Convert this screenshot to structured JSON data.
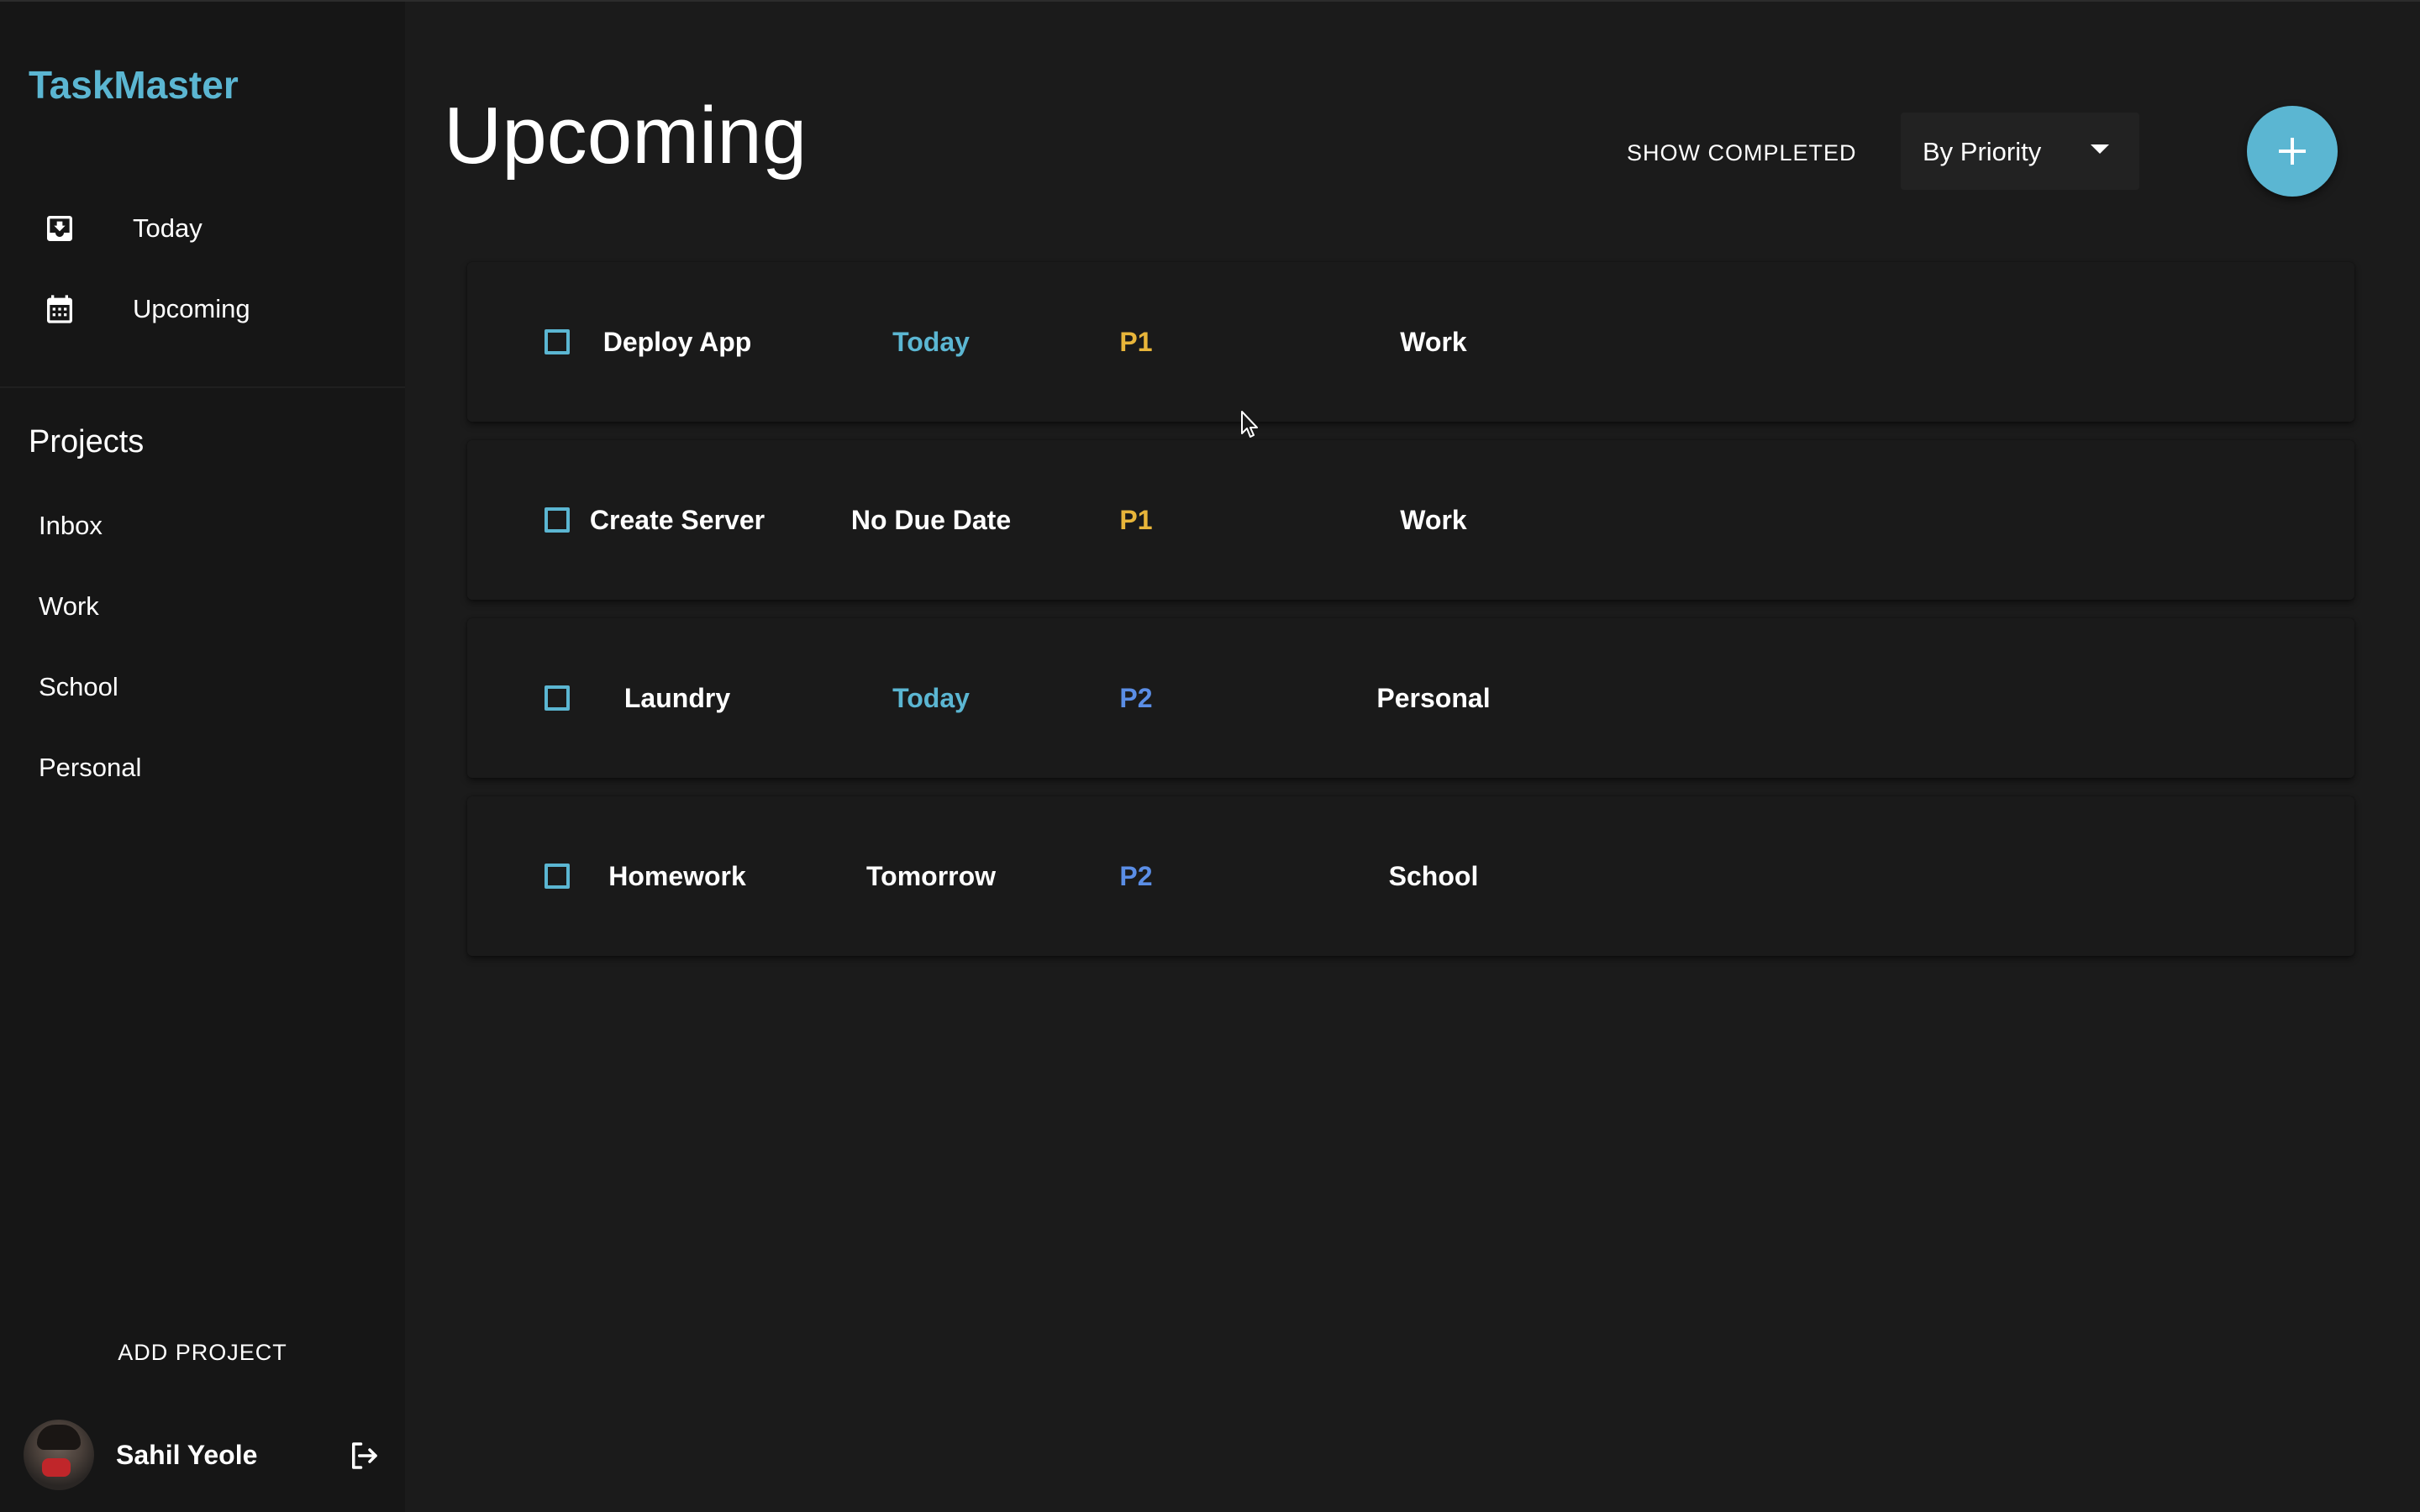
{
  "app": {
    "logo": "TaskMaster"
  },
  "sidebar": {
    "nav": [
      {
        "label": "Today",
        "icon": "inbox-download-icon"
      },
      {
        "label": "Upcoming",
        "icon": "calendar-icon"
      }
    ],
    "projects_title": "Projects",
    "projects": [
      {
        "label": "Inbox"
      },
      {
        "label": "Work"
      },
      {
        "label": "School"
      },
      {
        "label": "Personal"
      }
    ],
    "add_project_label": "ADD PROJECT",
    "user": {
      "name": "Sahil Yeole",
      "logout_icon": "logout-icon"
    }
  },
  "main": {
    "title": "Upcoming",
    "show_completed_label": "SHOW COMPLETED",
    "sort": {
      "selected": "By Priority"
    },
    "add_button_icon": "plus-icon"
  },
  "tasks": [
    {
      "name": "Deploy App",
      "due": "Today",
      "due_color": "#5bb6d2",
      "priority": "P1",
      "priority_color": "#e8b53a",
      "project": "Work"
    },
    {
      "name": "Create Server",
      "due": "No Due Date",
      "due_color": "#ffffff",
      "priority": "P1",
      "priority_color": "#e8b53a",
      "project": "Work"
    },
    {
      "name": "Laundry",
      "due": "Today",
      "due_color": "#5bb6d2",
      "priority": "P2",
      "priority_color": "#5b8ee6",
      "project": "Personal"
    },
    {
      "name": "Homework",
      "due": "Tomorrow",
      "due_color": "#ffffff",
      "priority": "P2",
      "priority_color": "#5b8ee6",
      "project": "School"
    }
  ],
  "colors": {
    "accent": "#5bb6d2",
    "background": "#1b1b1b",
    "sidebar": "#161616",
    "p1": "#e8b53a",
    "p2": "#5b8ee6"
  }
}
